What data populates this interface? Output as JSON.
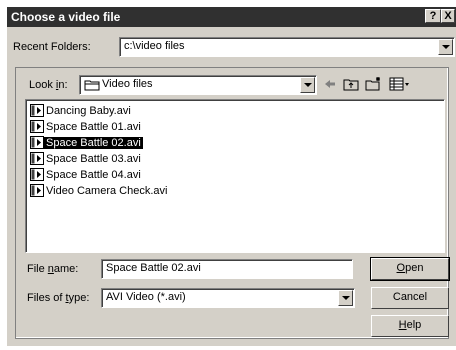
{
  "window": {
    "title": "Choose a video file",
    "help_btn": "?",
    "close_btn": "X"
  },
  "recent": {
    "label": "Recent Folders:",
    "value": "c:\\video files"
  },
  "look_in": {
    "label_pre": "Look ",
    "label_ul": "i",
    "label_post": "n:",
    "value": "Video files"
  },
  "files": [
    {
      "name": "Dancing Baby.avi",
      "selected": false
    },
    {
      "name": "Space Battle 01.avi",
      "selected": false
    },
    {
      "name": "Space Battle 02.avi",
      "selected": true
    },
    {
      "name": "Space Battle 03.avi",
      "selected": false
    },
    {
      "name": "Space Battle 04.avi",
      "selected": false
    },
    {
      "name": "Video Camera Check.avi",
      "selected": false
    }
  ],
  "file_name": {
    "label_pre": "File ",
    "label_ul": "n",
    "label_post": "ame:",
    "value": "Space Battle 02.avi"
  },
  "file_type": {
    "label_pre": "Files of ",
    "label_ul": "t",
    "label_post": "ype:",
    "value": "AVI Video (*.avi)"
  },
  "buttons": {
    "open": {
      "ul": "O",
      "rest": "pen"
    },
    "cancel": "Cancel",
    "help": {
      "ul": "H",
      "rest": "elp"
    }
  }
}
